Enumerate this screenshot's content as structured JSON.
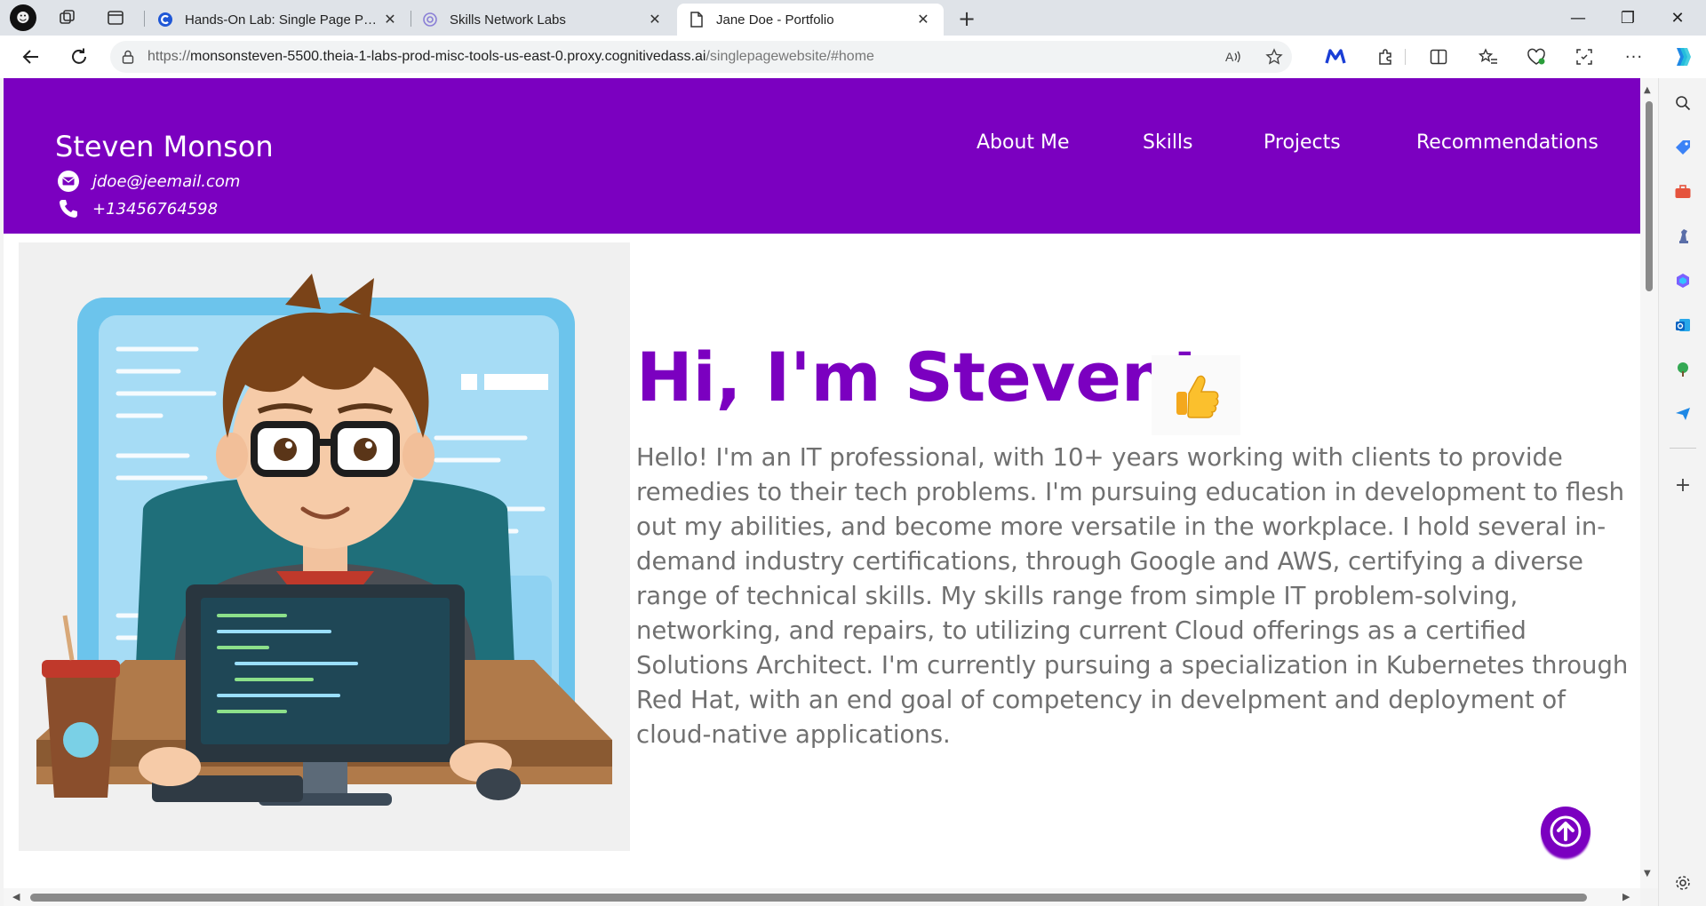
{
  "browser": {
    "tabs": [
      {
        "title": "Hands-On Lab: Single Page Portf",
        "favicon": "coursera-c-icon",
        "active": false
      },
      {
        "title": "Skills Network Labs",
        "favicon": "skills-network-icon",
        "active": false
      },
      {
        "title": "Jane Doe - Portfolio",
        "favicon": "page-icon",
        "active": true
      }
    ],
    "close_glyph": "✕",
    "new_tab_glyph": "+",
    "window_controls": {
      "minimize": "—",
      "maximize": "❐",
      "close": "✕"
    },
    "address": {
      "scheme": "https://",
      "host": "monsonsteven-5500.theia-1-labs-prod-misc-tools-us-east-0.proxy.cognitivedass.ai",
      "path": "/singlepagewebsite/#home"
    }
  },
  "site": {
    "name": "Steven Monson",
    "email": "jdoe@jeemail.com",
    "phone": "+13456764598",
    "nav": [
      "About Me",
      "Skills",
      "Projects",
      "Recommendations"
    ],
    "greeting": "Hi, I'm Steven!",
    "bio": "Hello! I'm an IT professional, with 10+ years working with clients to provide remedies to their tech problems. I'm pursuing education in development to flesh out my abilities, and become more versatile in the workplace. I hold several in-demand industry certifications, through Google and AWS, certifying a diverse range of technical skills. My skills range from simple IT problem-solving, networking, and repairs, to utilizing current Cloud offerings as a certified Solutions Architect. I'm currently pursuing a specialization in Kubernetes through Red Hat, with an end goal of competency in develpment and deployment of cloud-native applications.",
    "accent_color": "#7b00c0",
    "bio_color": "#707070",
    "hero_image": "cartoon-developer-at-computer-illustration",
    "emoji": "thumbs-up-emoji"
  }
}
